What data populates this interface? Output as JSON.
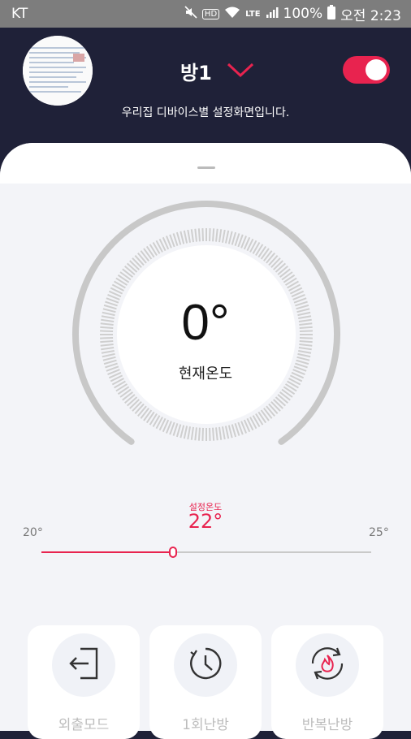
{
  "status_bar": {
    "carrier": "KT",
    "battery": "100%",
    "time": "오전 2:23",
    "lte": "LTE",
    "hd": "HD"
  },
  "header": {
    "room_name": "방1",
    "subtitle": "우리집 디바이스별 설정화면입니다.",
    "power_on": true
  },
  "thermostat": {
    "current_temp": "0°",
    "current_label": "현재온도"
  },
  "setpoint": {
    "caption": "설정온도",
    "value": "22°",
    "min_label": "20°",
    "max_label": "25°",
    "min": 20,
    "max": 25,
    "current": 22
  },
  "modes": [
    {
      "label": "외출모드",
      "icon": "exit-door-icon"
    },
    {
      "label": "1회난방",
      "icon": "timer-clock-icon"
    },
    {
      "label": "반복난방",
      "icon": "repeat-flame-icon"
    }
  ],
  "colors": {
    "accent": "#e8234f",
    "header_bg": "#1f2138",
    "panel_bg": "#f3f4f8"
  }
}
